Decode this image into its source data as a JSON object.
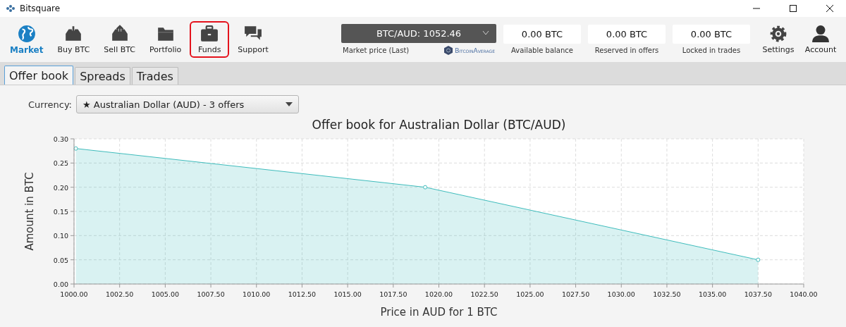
{
  "window": {
    "title": "Bitsquare"
  },
  "nav": [
    {
      "label": "Market",
      "selected": true,
      "highlighted": false
    },
    {
      "label": "Buy BTC",
      "selected": false,
      "highlighted": false
    },
    {
      "label": "Sell BTC",
      "selected": false,
      "highlighted": false
    },
    {
      "label": "Portfolio",
      "selected": false,
      "highlighted": false
    },
    {
      "label": "Funds",
      "selected": false,
      "highlighted": true
    },
    {
      "label": "Support",
      "selected": false,
      "highlighted": false
    }
  ],
  "market_price": {
    "value": "BTC/AUD: 1052.46",
    "caption": "Market price (Last)",
    "provider": "BitcoinAverage"
  },
  "balances": [
    {
      "value": "0.00 BTC",
      "caption": "Available balance"
    },
    {
      "value": "0.00 BTC",
      "caption": "Reserved in offers"
    },
    {
      "value": "0.00 BTC",
      "caption": "Locked in trades"
    }
  ],
  "right_nav": [
    {
      "label": "Settings"
    },
    {
      "label": "Account"
    }
  ],
  "tabs": [
    {
      "label": "Offer book",
      "selected": true
    },
    {
      "label": "Spreads",
      "selected": false
    },
    {
      "label": "Trades",
      "selected": false
    }
  ],
  "currency": {
    "label": "Currency:",
    "value": "★ Australian Dollar (AUD) - 3 offers"
  },
  "chart_data": {
    "type": "area",
    "title": "Offer book for Australian Dollar (BTC/AUD)",
    "xlabel": "Price in AUD for 1 BTC",
    "ylabel": "Amount in BTC",
    "x": [
      1000.1,
      1019.25,
      1037.5
    ],
    "series": [
      {
        "color": "#3fbcbc",
        "values": [
          0.28,
          0.2,
          0.05
        ]
      }
    ],
    "grid": true,
    "xlim": [
      1000,
      1040
    ],
    "ylim": [
      0,
      0.3
    ],
    "xticks": [
      {
        "value": 1000,
        "label": "1000.00"
      },
      {
        "value": 1002.5,
        "label": "1002.50"
      },
      {
        "value": 1005,
        "label": "1005.00"
      },
      {
        "value": 1007.5,
        "label": "1007.50"
      },
      {
        "value": 1010,
        "label": "1010.00"
      },
      {
        "value": 1012.5,
        "label": "1012.50"
      },
      {
        "value": 1015,
        "label": "1015.00"
      },
      {
        "value": 1017.5,
        "label": "1017.50"
      },
      {
        "value": 1020,
        "label": "1020.00"
      },
      {
        "value": 1022.5,
        "label": "1022.50"
      },
      {
        "value": 1025,
        "label": "1025.00"
      },
      {
        "value": 1027.5,
        "label": "1027.50"
      },
      {
        "value": 1030,
        "label": "1030.00"
      },
      {
        "value": 1032.5,
        "label": "1032.50"
      },
      {
        "value": 1035,
        "label": "1035.00"
      },
      {
        "value": 1037.5,
        "label": "1037.50"
      },
      {
        "value": 1040,
        "label": "1040.00"
      }
    ],
    "yticks": [
      {
        "value": 0,
        "label": "0.00"
      },
      {
        "value": 0.05,
        "label": "0.05"
      },
      {
        "value": 0.1,
        "label": "0.10"
      },
      {
        "value": 0.15,
        "label": "0.15"
      },
      {
        "value": 0.2,
        "label": "0.20"
      },
      {
        "value": 0.25,
        "label": "0.25"
      },
      {
        "value": 0.3,
        "label": "0.30"
      }
    ]
  }
}
